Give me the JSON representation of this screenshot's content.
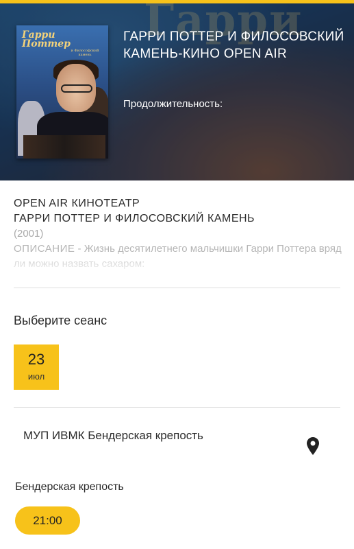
{
  "header": {
    "title": "ГАРРИ ПОТТЕР И ФИЛОСОВСКИЙ КАМЕНЬ-КИНО OPEN AIR",
    "duration_label": "Продолжительность:"
  },
  "poster": {
    "logo_text": "Гарри Поттер",
    "subtitle": "и Философский камень"
  },
  "info": {
    "cinema": "OPEN AIR КИНОТЕАТР",
    "film": "ГАРРИ ПОТТЕР И ФИЛОСОВСКИЙ КАМЕНЬ",
    "year": "(2001)",
    "description_label": "ОПИСАНИЕ",
    "description_text": " - Жизнь десятилетнего мальчишки Гарри Поттера вряд ли можно назвать сахаром:"
  },
  "session": {
    "choose_label": "Выберите сеанс",
    "date": {
      "day": "23",
      "month": "июл"
    },
    "venue": "МУП ИВМК Бендерская крепость",
    "venue_icon": "map-pin-icon",
    "hall": "Бендерская крепость",
    "time": "21:00"
  },
  "colors": {
    "accent": "#f7c21a",
    "text": "#2a2a2a",
    "muted": "#b5b5b5",
    "divider": "#dddddd"
  }
}
